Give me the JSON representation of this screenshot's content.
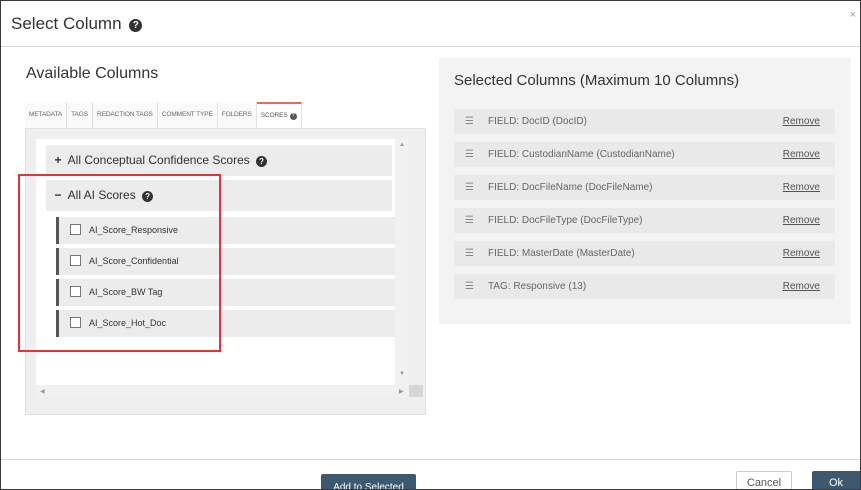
{
  "dialog": {
    "title": "Select Column",
    "close_symbol": "×"
  },
  "available": {
    "title": "Available Columns",
    "tabs": [
      {
        "label": "METADATA"
      },
      {
        "label": "TAGS"
      },
      {
        "label": "REDACTION TAGS"
      },
      {
        "label": "COMMENT TYPE"
      },
      {
        "label": "FOLDERS"
      },
      {
        "label": "SCORES"
      }
    ],
    "groups": [
      {
        "symbol": "+",
        "label": "All Conceptual Confidence Scores"
      },
      {
        "symbol": "−",
        "label": "All AI Scores"
      }
    ],
    "ai_scores": [
      {
        "label": "AI_Score_Responsive"
      },
      {
        "label": "AI_Score_Confidential"
      },
      {
        "label": "AI_Score_BW Tag"
      },
      {
        "label": "AI_Score_Hot_Doc"
      }
    ],
    "add_button": "Add to Selected"
  },
  "selected": {
    "title": "Selected Columns (Maximum 10 Columns)",
    "drag_symbol": "☰",
    "remove_label": "Remove",
    "rows": [
      {
        "label": "FIELD: DocID (DocID)"
      },
      {
        "label": "FIELD: CustodianName (CustodianName)"
      },
      {
        "label": "FIELD: DocFileName (DocFileName)"
      },
      {
        "label": "FIELD: DocFileType (DocFileType)"
      },
      {
        "label": "FIELD: MasterDate (MasterDate)"
      },
      {
        "label": "TAG: Responsive (13)"
      }
    ]
  },
  "footer": {
    "cancel": "Cancel",
    "ok": "Ok"
  },
  "colors": {
    "primary_button": "#3d5970",
    "active_tab_accent": "#e8685a",
    "highlight_box": "#e0343a"
  }
}
